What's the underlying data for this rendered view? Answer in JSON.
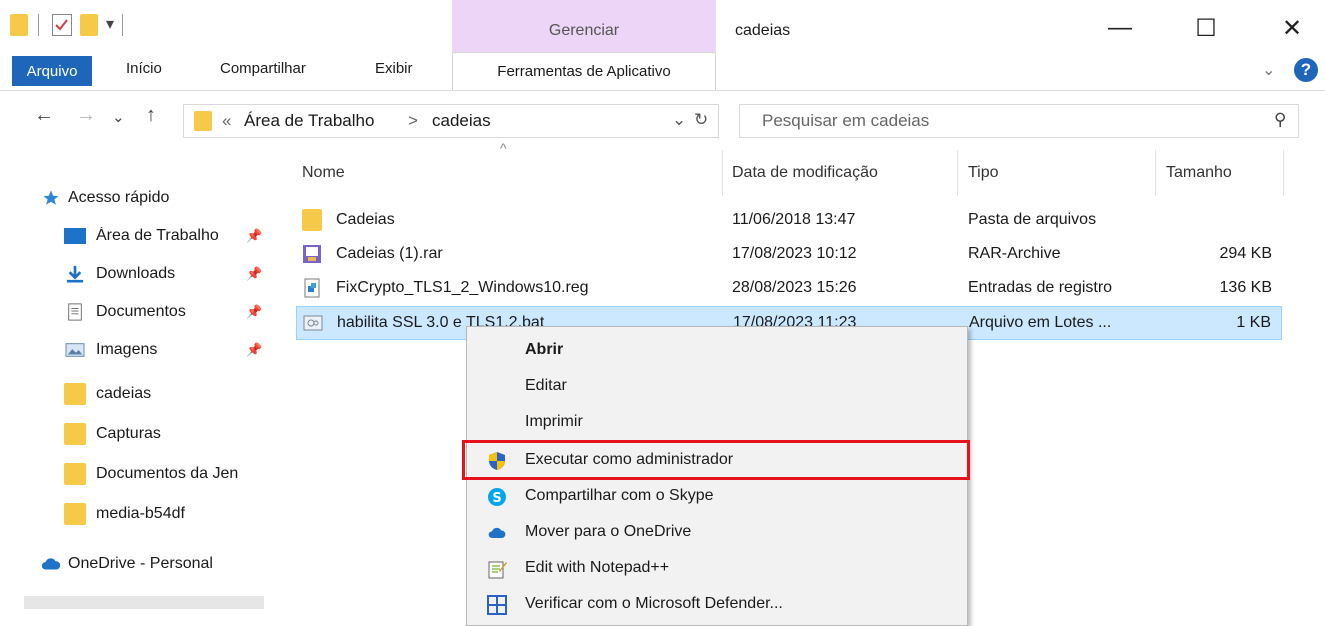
{
  "window": {
    "title": "cadeias",
    "context_tab_group": "Gerenciar",
    "minimize": "—",
    "maximize": "☐",
    "close": "✕"
  },
  "quick_access": {
    "dropdown": "▾"
  },
  "ribbon": {
    "tabs": [
      "Arquivo",
      "Início",
      "Compartilhar",
      "Exibir",
      "Ferramentas de Aplicativo"
    ],
    "collapse": "⌄",
    "help": "?"
  },
  "address": {
    "back": "←",
    "forward": "→",
    "recent": "⌄",
    "up": "↑",
    "overflow": "«",
    "crumbs": [
      "Área de Trabalho",
      "cadeias"
    ],
    "separator": ">",
    "dropdown": "⌄",
    "refresh": "↻"
  },
  "search": {
    "placeholder": "Pesquisar em cadeias",
    "icon": "⚲"
  },
  "sidebar": {
    "items": [
      {
        "label": "Acesso rápido",
        "icon": "star-icon"
      },
      {
        "label": "Área de Trabalho",
        "icon": "desktop-icon",
        "pinned": true
      },
      {
        "label": "Downloads",
        "icon": "download-icon",
        "pinned": true
      },
      {
        "label": "Documentos",
        "icon": "document-icon",
        "pinned": true
      },
      {
        "label": "Imagens",
        "icon": "images-icon",
        "pinned": true
      },
      {
        "label": "cadeias",
        "icon": "folder-icon"
      },
      {
        "label": "Capturas",
        "icon": "folder-icon"
      },
      {
        "label": "Documentos da Jen",
        "icon": "folder-icon"
      },
      {
        "label": "media-b54df",
        "icon": "folder-icon"
      },
      {
        "label": "OneDrive - Personal",
        "icon": "onedrive-icon"
      }
    ],
    "pin_glyph": "📌"
  },
  "list": {
    "sort_indicator": "^",
    "columns": [
      "Nome",
      "Data de modificação",
      "Tipo",
      "Tamanho"
    ],
    "rows": [
      {
        "name": "Cadeias",
        "date": "11/06/2018 13:47",
        "type": "Pasta de arquivos",
        "size": "",
        "icon": "folder-icon"
      },
      {
        "name": "Cadeias (1).rar",
        "date": "17/08/2023 10:12",
        "type": "RAR-Archive",
        "size": "294 KB",
        "icon": "rar-icon"
      },
      {
        "name": "FixCrypto_TLS1_2_Windows10.reg",
        "date": "28/08/2023 15:26",
        "type": "Entradas de registro",
        "size": "136 KB",
        "icon": "reg-icon"
      },
      {
        "name": "habilita SSL 3.0 e TLS1.2.bat",
        "date": "17/08/2023 11:23",
        "type": "Arquivo em Lotes ...",
        "size": "1 KB",
        "icon": "bat-icon"
      }
    ]
  },
  "context_menu": {
    "items": [
      {
        "label": "Abrir",
        "bold": true,
        "icon": ""
      },
      {
        "label": "Editar",
        "icon": ""
      },
      {
        "label": "Imprimir",
        "icon": ""
      },
      {
        "label": "Executar como administrador",
        "icon": "uac-shield-icon",
        "highlighted": true
      },
      {
        "label": "Compartilhar com o Skype",
        "icon": "skype-icon"
      },
      {
        "label": "Mover para o OneDrive",
        "icon": "onedrive-icon"
      },
      {
        "label": "Edit with Notepad++",
        "icon": "notepadpp-icon"
      },
      {
        "label": "Verificar com o Microsoft Defender...",
        "icon": "defender-icon"
      }
    ]
  },
  "colors": {
    "accent": "#1d66b9",
    "manage_tab": "#ecd5f6",
    "selection": "#cce8ff",
    "highlight_box": "#e8121f",
    "folder": "#f7c948"
  }
}
